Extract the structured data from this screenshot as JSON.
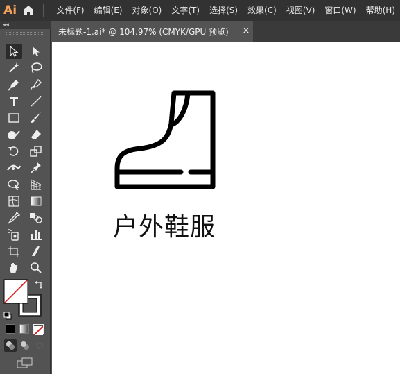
{
  "app": {
    "logo": "Ai"
  },
  "menu": [
    "文件(F)",
    "编辑(E)",
    "对象(O)",
    "文字(T)",
    "选择(S)",
    "效果(C)",
    "视图(V)",
    "窗口(W)",
    "帮助(H)"
  ],
  "document": {
    "tab_label": "未标题-1.ai* @ 104.97% (CMYK/GPU 预览)",
    "close": "×"
  },
  "toolbar": {
    "collapse": "◂◂"
  },
  "canvas": {
    "text": "户外鞋服"
  },
  "colors": {
    "menubar_bg": "#323232",
    "panel_bg": "#535353",
    "logo": "#f7a25b",
    "artwork": "#000000",
    "none_swatch_slash": "#e02020"
  },
  "icons": {
    "top": [
      "home-icon"
    ],
    "tools": [
      "selection-tool-icon",
      "direct-selection-tool-icon",
      "magic-wand-icon",
      "lasso-icon",
      "pen-tool-icon",
      "curvature-tool-icon",
      "type-tool-icon",
      "line-segment-icon",
      "rectangle-tool-icon",
      "paintbrush-icon",
      "shaper-tool-icon",
      "eraser-icon",
      "rotate-tool-icon",
      "scale-tool-icon",
      "width-tool-icon",
      "puppet-warp-icon",
      "shape-builder-icon",
      "perspective-grid-icon",
      "mesh-tool-icon",
      "gradient-tool-icon",
      "eyedropper-icon",
      "blend-tool-icon",
      "symbol-sprayer-icon",
      "column-graph-icon",
      "artboard-tool-icon",
      "slice-tool-icon",
      "hand-tool-icon",
      "zoom-tool-icon",
      "fill-stroke-icon",
      "swap-fill-stroke-icon",
      "default-fill-stroke-icon",
      "color-mode-icon",
      "gradient-mode-icon",
      "none-mode-icon",
      "draw-normal-icon",
      "draw-behind-icon",
      "draw-inside-icon",
      "change-screen-mode-icon"
    ]
  }
}
